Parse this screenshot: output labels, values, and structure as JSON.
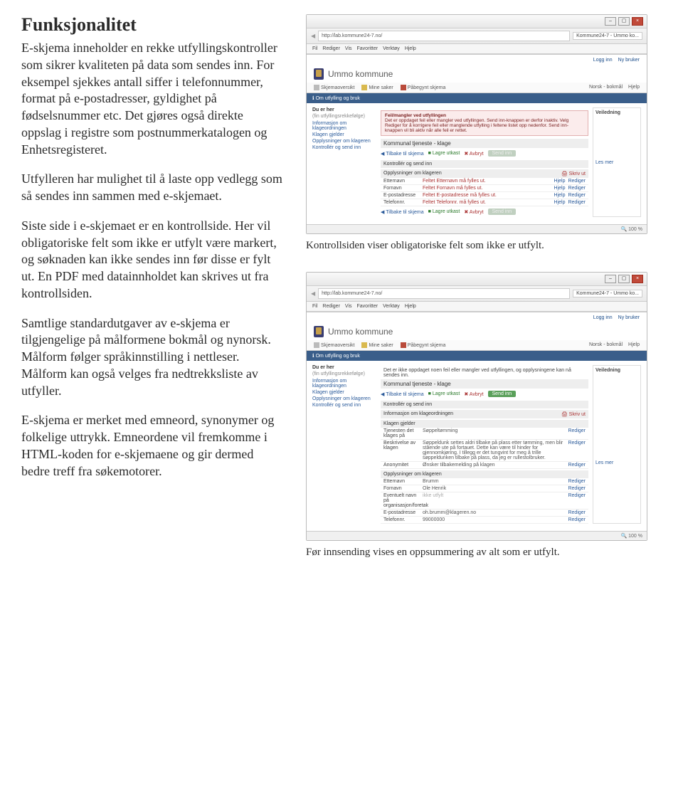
{
  "left": {
    "heading": "Funksjonalitet",
    "p1": "E-skjema inneholder en rekke utfyllingskontroller som sikrer kvaliteten på data som sendes inn. For eksempel sjekkes antall siffer i telefonnummer, format på e-postadresser, gyldighet på fødselsnummer etc. Det gjøres også direkte oppslag i registre som postnummerkatalogen og Enhetsregisteret.",
    "p2": "Utfylleren har mulighet til å laste opp vedlegg som så sendes inn sammen med e-skjemaet.",
    "p3": "Siste side i e-skjemaet er en kontrollside. Her vil obligatoriske felt som ikke er utfylt være markert, og søknaden kan ikke sendes inn før disse er fylt ut. En PDF med datainnholdet kan skrives ut fra kontrollsiden.",
    "p4": "Samtlige standardutgaver av e-skjema er tilgjengelige på målformene bokmål og nynorsk. Målform følger språkinnstilling i nettleser. Målform kan også velges fra nedtrekksliste av utfyller.",
    "p5": "E-skjema er merket med emneord, synonymer og folkelige uttrykk. Emneordene vil fremkomme i HTML-koden for e-skjemaene og gir dermed bedre treff fra søkemotorer."
  },
  "captions": {
    "c1": "Kontrollsiden viser obligatoriske felt som ikke er utfylt.",
    "c2": "Før innsending vises en oppsummering av alt som er utfylt."
  },
  "mock": {
    "url": "http://lab.kommune24-7.no/",
    "tab": "Kommune24-7 - Ummo ko...",
    "menu": [
      "Fil",
      "Rediger",
      "Vis",
      "Favoritter",
      "Verktøy",
      "Hjelp"
    ],
    "login": "Logg inn",
    "newuser": "Ny bruker",
    "site": "Ummo kommune",
    "navtabs": [
      "Skjemaoversikt",
      "Mine saker",
      "Påbegynt skjema"
    ],
    "lang": "Norsk - bokmål",
    "help": "Hjelp",
    "subbar": "Om utfylling og bruk",
    "leftnav_hd": "Du er her",
    "leftnav_sm": "(fin utfyllingsrekkefølge)",
    "leftnav_items": [
      "Informasjon om klageordningen",
      "Klagen gjelder",
      "Opplysninger om klageren",
      "Kontrollér og send inn"
    ],
    "panel_title": "Kommunal tjeneste - klage",
    "btns_back": "Tilbake til skjema",
    "btns_save": "Lagre utkast",
    "btns_cancel": "Avbryt",
    "btns_send": "Send inn",
    "sec_kontroller": "Kontrollér og send inn",
    "sec_opp": "Opplysninger om klageren",
    "skrivut": "Skriv ut",
    "help2": "Hjelp",
    "rediger": "Rediger",
    "err_rows": [
      {
        "k": "Etternavn",
        "v": "Feltet Etternavn må fylles ut."
      },
      {
        "k": "Fornavn",
        "v": "Feltet Fornavn må fylles ut."
      },
      {
        "k": "E-postadresse",
        "v": "Feltet E-postadresse må fylles ut."
      },
      {
        "k": "Telefonnr.",
        "v": "Feltet Telefonnr. må fylles ut."
      }
    ],
    "veiledning": "Veiledning",
    "lesmer": "Les mer",
    "zoom": "100 %",
    "errbox_hd": "Feil/mangler ved utfyllingen",
    "errbox_tx": "Det er oppdaget feil eller mangler ved utfyllingen. Send inn-knappen er derfor inaktiv. Velg Rediger for å korrigere feil eller manglende utfylling i feltene listet opp nedenfor. Send inn-knappen vil bli aktiv når alle feil er rettet.",
    "okmsg": "Det er ikke oppdaget noen feil eller mangler ved utfyllingen, og opplysningene kan nå sendes inn.",
    "sec_info": "Informasjon om klageordningen",
    "sec_klagen": "Klagen gjelder",
    "sum_rows1": [
      {
        "k": "Tjenesten det klages på",
        "v": "Søppeltømming"
      },
      {
        "k": "Beskrivelse av klagen",
        "v": "Søppeldunk settes aldri tilbake på plass etter tømming, men blir stående ute på fortauet. Dette kan være til hinder for gjennomkjøring. I tillegg er det tungvint for meg å trille søppeldunken tilbake på plass, da jeg er rullestolbruker."
      },
      {
        "k": "Anonymitet",
        "v": "Ønsker tilbakemelding på klagen"
      }
    ],
    "sec_oppkl": "Opplysninger om klageren",
    "sum_rows2": [
      {
        "k": "Etternavn",
        "v": "Brumm"
      },
      {
        "k": "Fornavn",
        "v": "Ole Henrik"
      },
      {
        "k": "Eventuelt navn på organisasjon/foretak",
        "v": "ikke utfylt"
      },
      {
        "k": "E-postadresse",
        "v": "oh.brumm@klageren.no"
      },
      {
        "k": "Telefonnr.",
        "v": "99000000"
      }
    ]
  }
}
